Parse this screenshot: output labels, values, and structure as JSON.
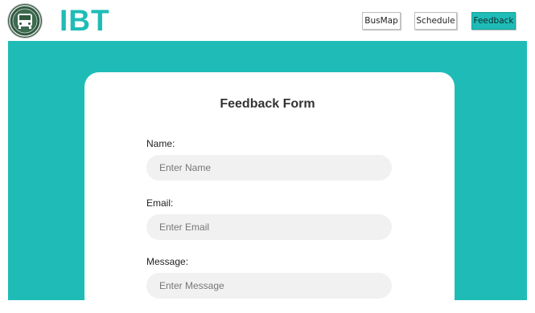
{
  "header": {
    "brand": "IBT",
    "nav": [
      {
        "label": "BusMap"
      },
      {
        "label": "Schedule"
      },
      {
        "label": "Feedback"
      }
    ]
  },
  "form": {
    "title": "Feedback Form",
    "fields": [
      {
        "label": "Name:",
        "placeholder": "Enter Name"
      },
      {
        "label": "Email:",
        "placeholder": "Enter Email"
      },
      {
        "label": "Message:",
        "placeholder": "Enter Message"
      }
    ]
  },
  "colors": {
    "accent": "#1fbcb7",
    "field_bg": "#f1f1f1"
  }
}
